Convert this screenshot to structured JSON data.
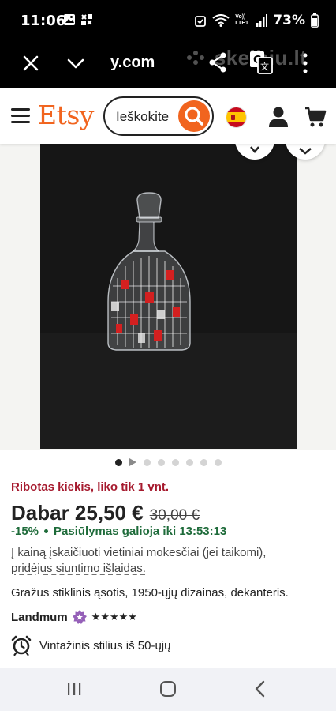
{
  "status_bar": {
    "time": "11:06",
    "network_label": "Vo)) LTE1",
    "battery": "73%"
  },
  "browser": {
    "url": "y.com",
    "watermark": "skelbiu.lt"
  },
  "header": {
    "logo": "Etsy",
    "search_text": "Ieškokite",
    "accent_color": "#f1641e"
  },
  "gallery": {
    "image_count": 7,
    "active_index": 0,
    "first_is_video": true
  },
  "product": {
    "stock_notice": "Ribotas kiekis, liko tik 1 vnt.",
    "price_now": "Dabar 25,50 €",
    "price_old": "30,00 €",
    "discount": "-15%",
    "offer": "Pasiūlymas galioja iki 13:53:13",
    "tax_text": "Į kainą įskaičiuoti vietiniai mokesčiai (jei taikomi),",
    "shipping_link": "pridėjus siuntimo išlaidas.",
    "title": "Gražus stiklinis ąsotis, 1950-ųjų dizainas, dekanteris.",
    "shop_name": "Landmum",
    "rating_stars": "★★★★★",
    "rating_value": 5,
    "vintage": "Vintažinis stilius iš 50-ųjų"
  }
}
